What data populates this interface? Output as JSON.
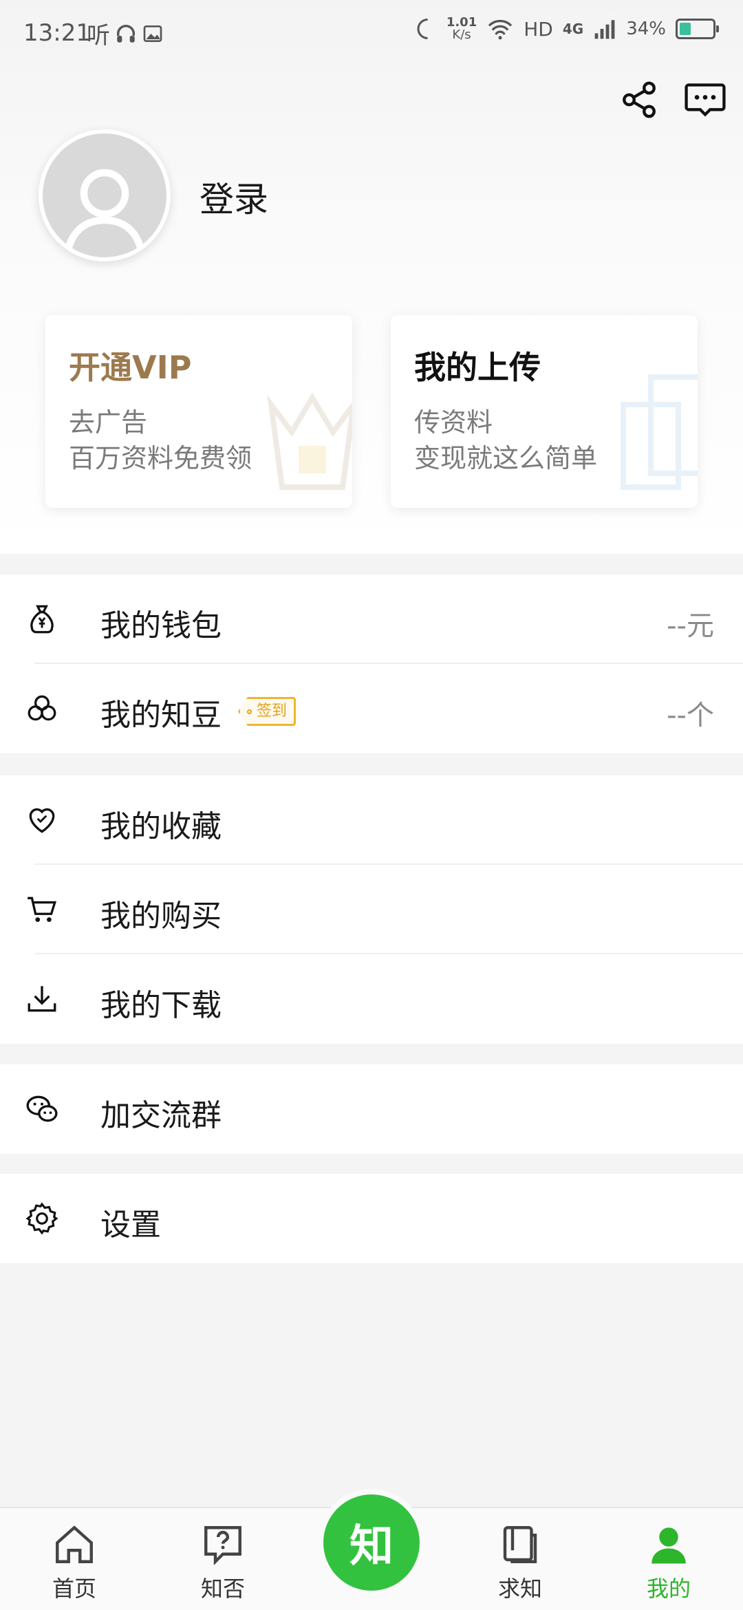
{
  "status_bar": {
    "time": "13:21",
    "app_glyph": "听",
    "net_speed_value": "1.01",
    "net_speed_unit": "K/s",
    "hd": "HD",
    "network": "4G",
    "battery_text": "34%",
    "battery_level": 0.34
  },
  "profile": {
    "login_label": "登录"
  },
  "cards": {
    "vip": {
      "title": "开通VIP",
      "line1": "去广告",
      "line2": "百万资料免费领"
    },
    "upload": {
      "title": "我的上传",
      "line1": "传资料",
      "line2": "变现就这么简单"
    }
  },
  "menu": {
    "wallet": {
      "label": "我的钱包",
      "value": "--元",
      "icon": "money-bag-icon"
    },
    "beans": {
      "label": "我的知豆",
      "tag": "签到",
      "value": "--个",
      "icon": "bean-icon"
    },
    "favorites": {
      "label": "我的收藏",
      "icon": "heart-icon"
    },
    "purchases": {
      "label": "我的购买",
      "icon": "cart-icon"
    },
    "downloads": {
      "label": "我的下载",
      "icon": "download-icon"
    },
    "group": {
      "label": "加交流群",
      "icon": "wechat-icon"
    },
    "settings": {
      "label": "设置",
      "icon": "gear-icon"
    }
  },
  "tabbar": {
    "home": "首页",
    "qa": "知否",
    "center": "知",
    "seek": "求知",
    "mine": "我的"
  },
  "colors": {
    "accent_green": "#2db52b",
    "vip_gold": "#9c7a4f",
    "tag_orange": "#f0b432"
  }
}
